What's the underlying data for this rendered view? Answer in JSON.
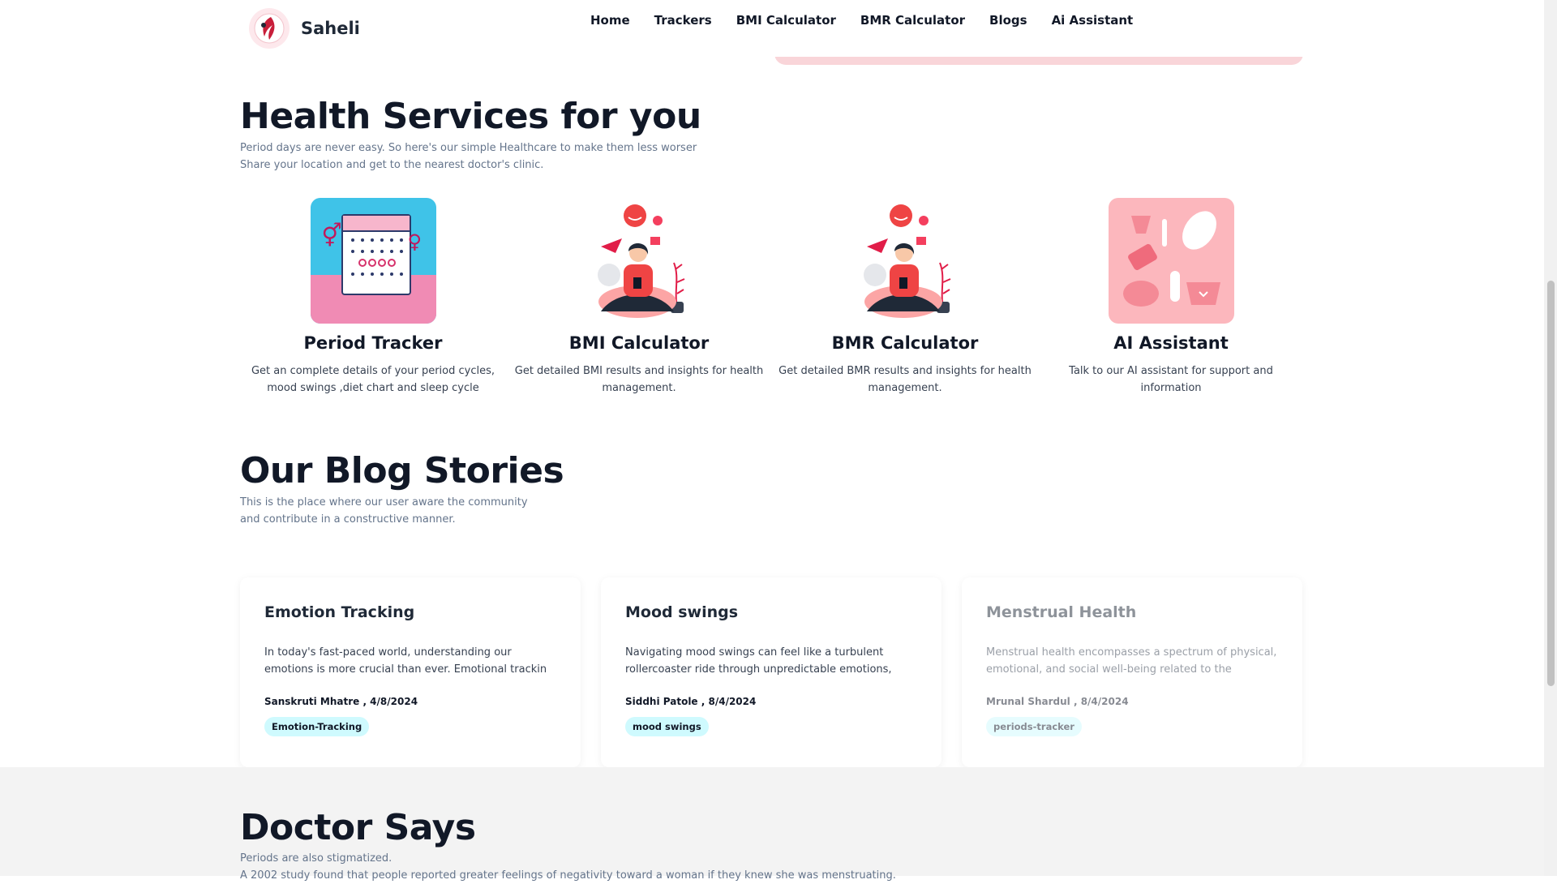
{
  "header": {
    "brand": "Saheli",
    "nav": [
      "Home",
      "Trackers",
      "BMI Calculator",
      "BMR Calculator",
      "Blogs",
      "Ai Assistant"
    ]
  },
  "services_section": {
    "title": "Health Services for you",
    "subtitle_line1": "Period days are never easy. So here's our simple Healthcare to make them less worser",
    "subtitle_line2": "Share your location and get to the nearest doctor's clinic.",
    "cards": [
      {
        "title": "Period Tracker",
        "description": "Get an complete details of your period cycles, mood swings ,diet chart and sleep cycle",
        "image": "menstrual-calendar-illustration"
      },
      {
        "title": "BMI Calculator",
        "description": "Get detailed BMI results and insights for health management.",
        "image": "woman-with-phone-illustration"
      },
      {
        "title": "BMR Calculator",
        "description": "Get detailed BMR results and insights for health management.",
        "image": "woman-with-phone-illustration"
      },
      {
        "title": "AI Assistant",
        "description": "Talk to our AI assistant for support and information",
        "image": "menstrual-products-illustration"
      }
    ]
  },
  "blog_section": {
    "title": "Our Blog Stories",
    "subtitle_line1": "This is the place where our user aware the community",
    "subtitle_line2": "and contribute in a constructive manner.",
    "posts": [
      {
        "title": "Emotion Tracking",
        "excerpt": "In today's fast-paced world, understanding our emotions is more crucial than ever. Emotional trackin",
        "author": "Sanskruti Mhatre , 4/8/2024",
        "tag": "Emotion-Tracking"
      },
      {
        "title": "Mood swings",
        "excerpt": "Navigating mood swings can feel like a turbulent rollercoaster ride through unpredictable emotions,",
        "author": "Siddhi Patole , 8/4/2024",
        "tag": "mood swings"
      },
      {
        "title": "Menstrual Health",
        "excerpt": "Menstrual health encompasses a spectrum of physical, emotional, and social well-being related to the",
        "author": "Mrunal Shardul , 8/4/2024",
        "tag": "periods-tracker"
      }
    ]
  },
  "doctor_section": {
    "title": "Doctor Says",
    "line1": "Periods are also stigmatized.",
    "line2": "A 2002 study found that people reported greater feelings of negativity toward a woman if they knew she was menstruating."
  },
  "colors": {
    "accent_pink": "#f9d5d9",
    "tag_bg": "#cffafe",
    "muted_text": "#64748b"
  }
}
